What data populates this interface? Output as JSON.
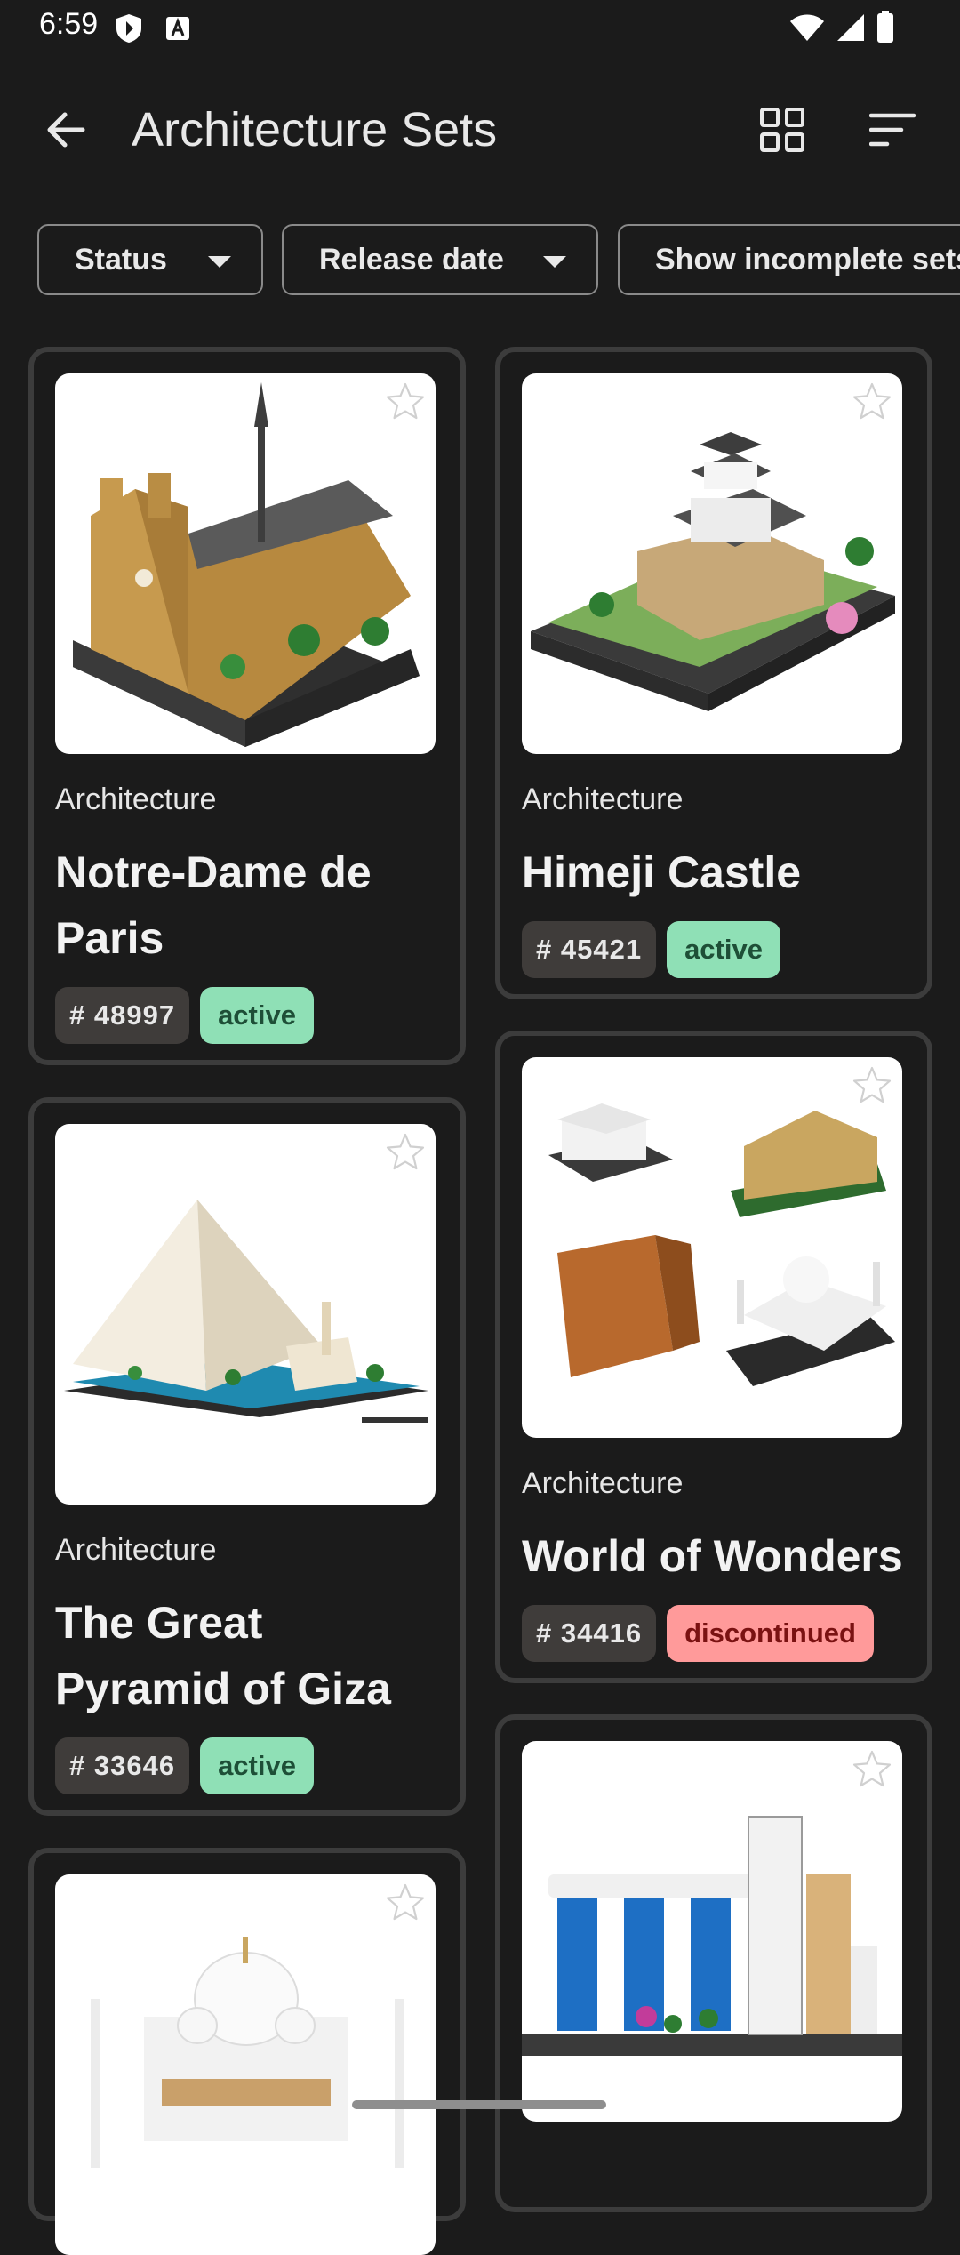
{
  "status_bar": {
    "time": "6:59"
  },
  "app_bar": {
    "title": "Architecture Sets",
    "icons": {
      "back": "arrow-left-icon",
      "grid": "grid-view-icon",
      "sort": "sort-icon"
    }
  },
  "filters": [
    {
      "label": "Status"
    },
    {
      "label": "Release date"
    },
    {
      "label": "Show incomplete sets"
    }
  ],
  "cards": [
    {
      "category": "Architecture",
      "title": "Notre-Dame de Paris",
      "number": "# 48997",
      "status": "active"
    },
    {
      "category": "Architecture",
      "title": "Himeji Castle",
      "number": "# 45421",
      "status": "active"
    },
    {
      "category": "Architecture",
      "title": "The Great Pyramid of Giza",
      "number": "# 33646",
      "status": "active"
    },
    {
      "category": "Architecture",
      "title": "World of Wonders",
      "number": "# 34416",
      "status": "discontinued"
    },
    {
      "category": "",
      "title": "",
      "number": "",
      "status": ""
    },
    {
      "category": "",
      "title": "",
      "number": "",
      "status": ""
    }
  ],
  "colors": {
    "background": "#1b1b1b",
    "card_border": "#3c3c3c",
    "active_badge": "#8fe0b6",
    "discontinued_badge": "#ff9a9a"
  }
}
